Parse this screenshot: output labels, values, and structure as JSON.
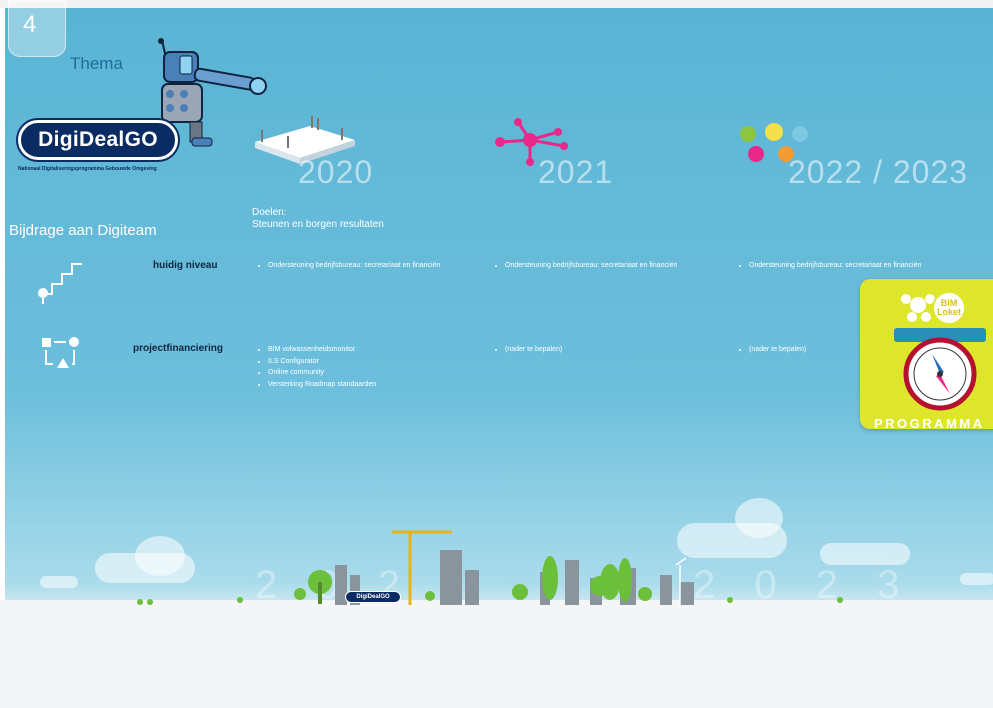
{
  "page_number": "4",
  "thema_label": "Thema",
  "logo": {
    "text_part": "DigiDeal",
    "go_part": "GO",
    "subtitle": "Nationaal Digitaliseringsprogramma Gebouwde Omgeving"
  },
  "years": [
    "2020",
    "2021",
    "2022 / 2023"
  ],
  "section_title": "Bijdrage aan Digiteam",
  "doelen": {
    "label": "Doelen:",
    "text": "Steunen en borgen resultaten"
  },
  "rows": [
    {
      "label": "huidig niveau",
      "cells": [
        [
          "Ondersteuning bedrijfsbureau: secretariaat en financiën"
        ],
        [
          "Ondersteuning bedrijfsbureau: secretariaat en financiën"
        ],
        [
          "Ondersteuning bedrijfsbureau: secretariaat en financiën"
        ]
      ]
    },
    {
      "label": "projectfinanciering",
      "cells": [
        [
          "BIM volwassenheidsmonitor",
          "ILS Configurator",
          "Online community",
          "Versterking Roadmap standaarden"
        ],
        [
          "(nader te bepalen)"
        ],
        [
          "(nader te bepalen)"
        ]
      ]
    }
  ],
  "badge": {
    "bim_label": "BIM\nLoket",
    "bottom_text": "PROGRAMMA"
  },
  "footer_logo": "DigiDealGO",
  "background_years": {
    "left": "2 0 2",
    "right": "2 0 2 3"
  },
  "icons": [
    "robot-telescope-icon",
    "slab-icon",
    "network-icon",
    "lightbulbs-icon",
    "stairs-icon",
    "flow-icon",
    "compass-icon",
    "puzzle-icon"
  ]
}
